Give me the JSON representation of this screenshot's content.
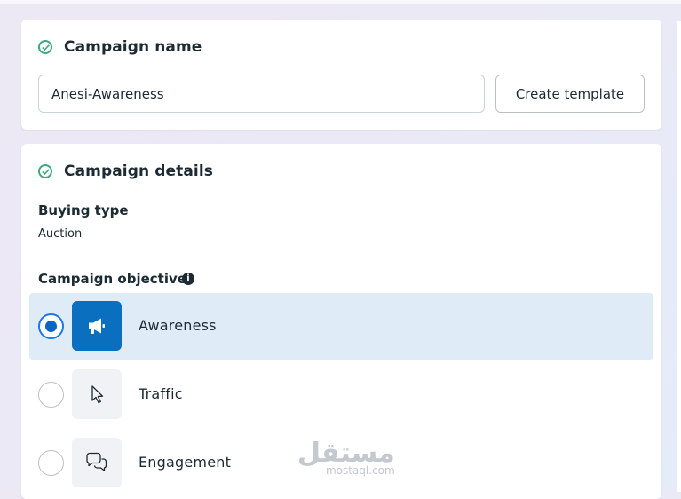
{
  "campaign_name": {
    "title": "Campaign name",
    "input_value": "Anesi-Awareness",
    "create_template_label": "Create template"
  },
  "campaign_details": {
    "title": "Campaign details",
    "buying_type_label": "Buying type",
    "buying_type_value": "Auction",
    "objective_label": "Campaign objective",
    "info_icon": "info-icon",
    "options": [
      {
        "label": "Awareness",
        "icon": "megaphone-icon",
        "selected": true
      },
      {
        "label": "Traffic",
        "icon": "cursor-icon",
        "selected": false
      },
      {
        "label": "Engagement",
        "icon": "chat-bubbles-icon",
        "selected": false
      }
    ]
  },
  "watermark": {
    "arabic": "مستقل",
    "latin": "mostaql.com"
  },
  "colors": {
    "accent": "#0a66c2",
    "check": "#3ea87e",
    "selected_bg": "#dfebf6"
  }
}
